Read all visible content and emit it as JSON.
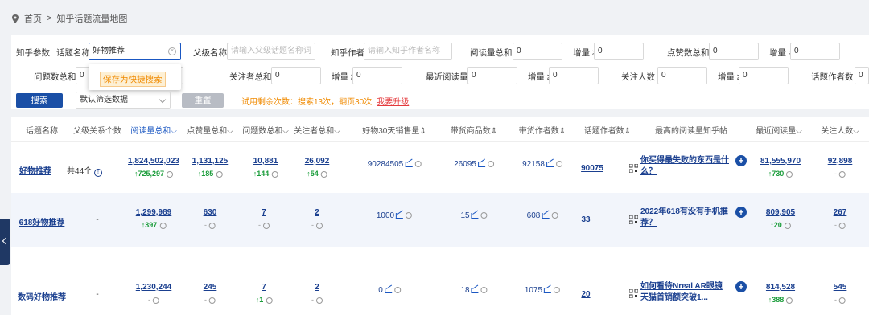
{
  "breadcrumb": {
    "home": "首页",
    "sep": ">",
    "current": "知乎话题流量地图"
  },
  "filters": {
    "section_label": "知乎参数",
    "topic_name_label": "话题名称:",
    "topic_name_value": "好物推荐",
    "parent_label": "父级名称:",
    "parent_placeholder": "请输入父级话题名称词",
    "author_label": "知乎作者:",
    "author_placeholder": "请输入知乎作者名称",
    "read_total_label": "阅读量总和 ≥",
    "read_total_value": "0",
    "read_inc_label": "增量 ≥",
    "read_inc_value": "0",
    "like_total_label": "点赞数总和 ≥",
    "like_total_value": "0",
    "like_inc_label": "增量 ≥",
    "like_inc_value": "0",
    "q_total_label": "问题数总和 ≥",
    "q_total_value": "0",
    "follow_total_label": "关注者总和 ≥",
    "follow_total_value": "0",
    "follow_inc_label": "增量 ≥",
    "follow_inc_value": "0",
    "recent_read_label": "最近阅读量 ≥",
    "recent_read_value": "0",
    "recent_inc_label": "增量 ≥",
    "recent_inc_value": "0",
    "followers_label": "关注人数 ≥",
    "followers_value": "0",
    "followers_inc_label": "增量 ≥",
    "followers_inc_value": "0",
    "authors_label": "话题作者数 ≥",
    "authors_value": "0",
    "tooltip": "保存为快捷搜索",
    "search_button": "搜索",
    "default_select": "默认筛选数据",
    "reset_button": "重置",
    "trial_text": "试用剩余次数：搜索13次，翻页30次",
    "upgrade_link": "我要升级"
  },
  "table": {
    "headers": [
      "话题名称",
      "父级关系个数",
      "阅读量总和",
      "点赞量总和",
      "问题数总和",
      "关注者总和",
      "好物30天销售量",
      "带货商品数",
      "带货作者数",
      "话题作者数",
      "最高的阅读量知乎帖",
      "最近阅读量",
      "关注人数"
    ],
    "rows": [
      {
        "name": "好物推荐",
        "parent": "共44个",
        "read": "1,824,502,023",
        "read_inc": "725,297",
        "like": "1,131,125",
        "like_inc": "185",
        "question": "10,881",
        "question_inc": "144",
        "follow": "26,092",
        "follow_inc": "54",
        "sales": "90284505",
        "goods": "26095",
        "sellers": "92158",
        "authors": "90075",
        "top_post": "你买得最失败的东西是什么？",
        "recent": "81,555,970",
        "recent_inc": "730",
        "fans": "92,898",
        "fans_inc": "-"
      },
      {
        "name": "618好物推荐",
        "parent": "-",
        "read": "1,299,989",
        "read_inc": "397",
        "like": "630",
        "like_inc": "-",
        "question": "7",
        "question_inc": "-",
        "follow": "2",
        "follow_inc": "-",
        "sales": "1000",
        "goods": "15",
        "sellers": "608",
        "authors": "33",
        "top_post": "2022年618有没有手机推荐？",
        "recent": "809,905",
        "recent_inc": "20",
        "fans": "267",
        "fans_inc": "-"
      },
      {
        "name": "数码好物推荐",
        "parent": "-",
        "read": "1,230,244",
        "read_inc": "-",
        "like": "245",
        "like_inc": "-",
        "question": "7",
        "question_inc": "1",
        "follow": "2",
        "follow_inc": "-",
        "sales": "0",
        "goods": "18",
        "sellers": "1075",
        "authors": "20",
        "top_post": "如何看待Nreal AR眼镜天猫首销额突破1...",
        "recent": "814,528",
        "recent_inc": "388",
        "fans": "545",
        "fans_inc": "-"
      }
    ]
  },
  "colors": {
    "primary": "#1a4fa6",
    "link": "#1a3f8f",
    "increase": "#1a9c3a",
    "warning": "#f08a00"
  }
}
